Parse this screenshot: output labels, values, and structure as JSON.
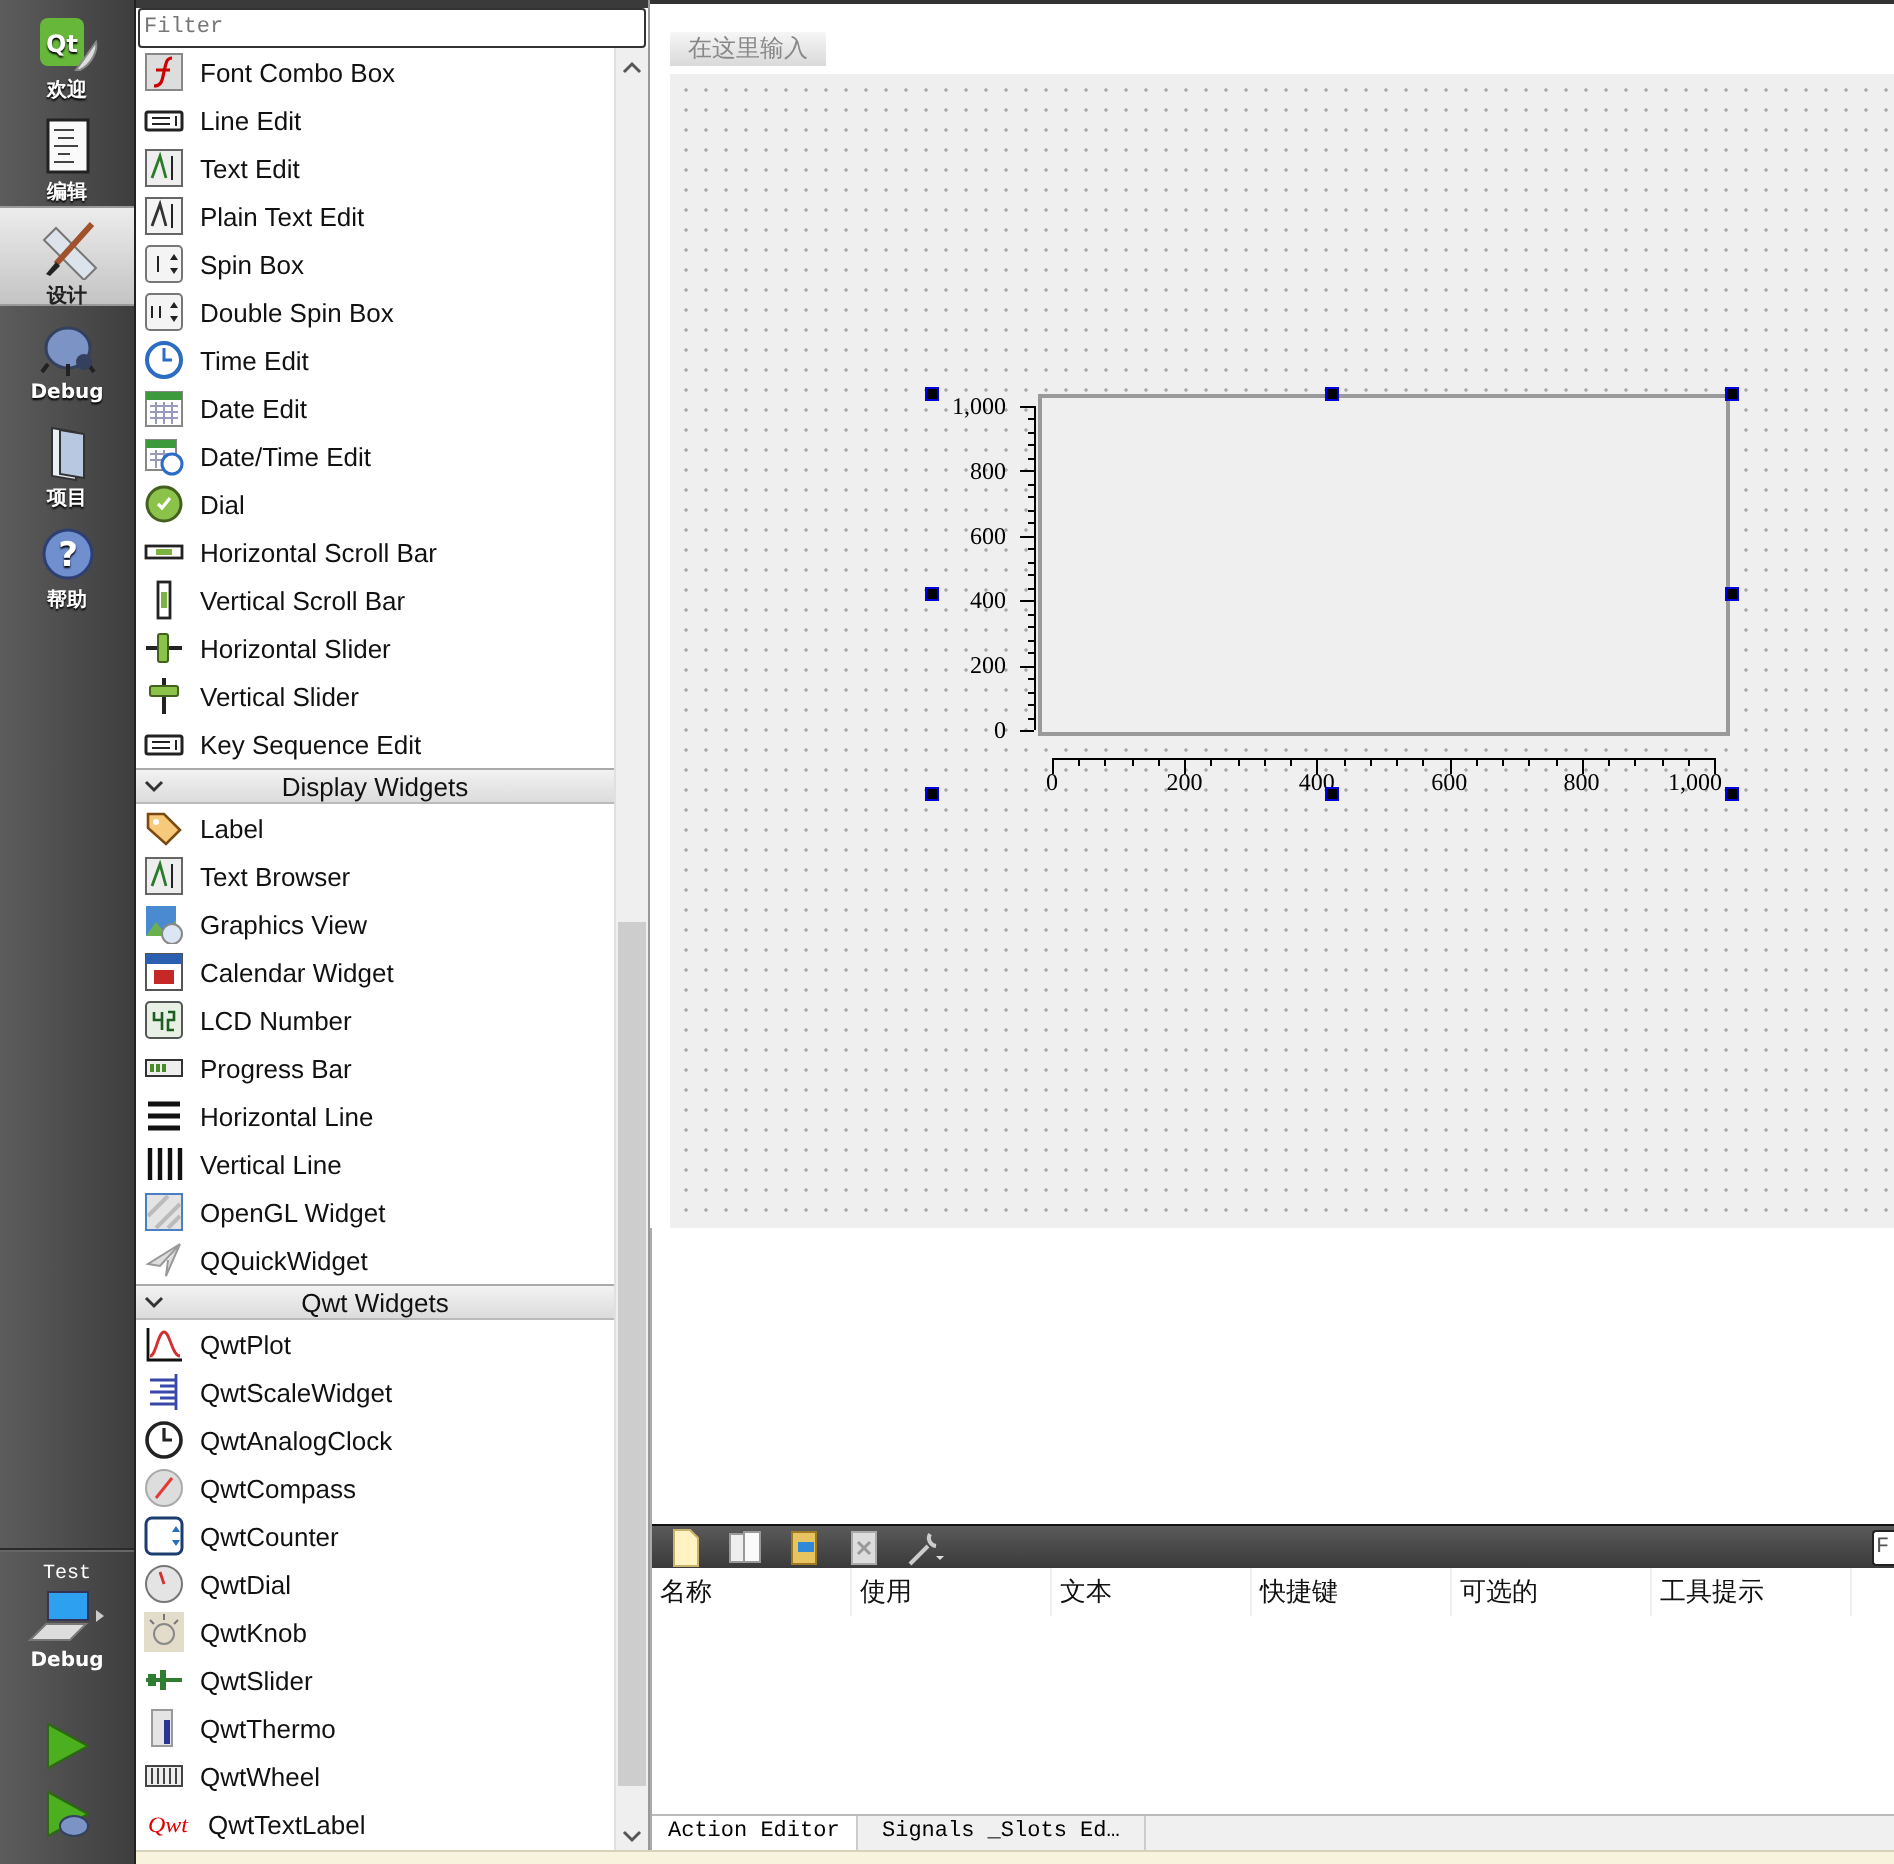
{
  "mode_bar": {
    "modes": [
      {
        "kind": "welcome",
        "label": "欢迎",
        "icon_text": "Qt",
        "selected": false
      },
      {
        "kind": "edit",
        "label": "编辑",
        "selected": false
      },
      {
        "kind": "design",
        "label": "设计",
        "selected": true
      },
      {
        "kind": "debug",
        "label": "Debug",
        "selected": false
      },
      {
        "kind": "projects",
        "label": "项目",
        "selected": false
      },
      {
        "kind": "help",
        "label": "帮助",
        "icon_text": "?",
        "selected": false
      }
    ],
    "kit": {
      "project": "Test",
      "build": "Debug"
    }
  },
  "widget_box": {
    "filter": {
      "placeholder": "Filter"
    },
    "sections": [
      {
        "items": [
          {
            "kind": "font",
            "label": "Font Combo Box"
          },
          {
            "kind": "line-edit",
            "label": "Line Edit"
          },
          {
            "kind": "text-edit",
            "label": "Text Edit"
          },
          {
            "kind": "plain-text",
            "label": "Plain Text Edit"
          },
          {
            "kind": "spin",
            "label": "Spin Box"
          },
          {
            "kind": "double-spin",
            "label": "Double Spin Box"
          },
          {
            "kind": "time",
            "label": "Time Edit"
          },
          {
            "kind": "date",
            "label": "Date Edit"
          },
          {
            "kind": "datetime",
            "label": "Date/Time Edit"
          },
          {
            "kind": "dial",
            "label": "Dial"
          },
          {
            "kind": "hscroll",
            "label": "Horizontal Scroll Bar"
          },
          {
            "kind": "vscroll",
            "label": "Vertical Scroll Bar"
          },
          {
            "kind": "hslider",
            "label": "Horizontal Slider"
          },
          {
            "kind": "vslider",
            "label": "Vertical Slider"
          },
          {
            "kind": "line-edit",
            "label": "Key Sequence Edit"
          }
        ]
      },
      {
        "title": "Display Widgets",
        "expanded": true,
        "items": [
          {
            "kind": "label",
            "label": "Label"
          },
          {
            "kind": "text-edit",
            "label": "Text Browser"
          },
          {
            "kind": "graphics",
            "label": "Graphics View"
          },
          {
            "kind": "calendar",
            "label": "Calendar Widget"
          },
          {
            "kind": "lcd",
            "label": "LCD Number"
          },
          {
            "kind": "progress",
            "label": "Progress Bar"
          },
          {
            "kind": "hline",
            "label": "Horizontal Line"
          },
          {
            "kind": "vline",
            "label": "Vertical Line"
          },
          {
            "kind": "opengl",
            "label": "OpenGL Widget"
          },
          {
            "kind": "quick",
            "label": "QQuickWidget"
          }
        ]
      },
      {
        "title": "Qwt Widgets",
        "expanded": true,
        "items": [
          {
            "kind": "plot",
            "label": "QwtPlot"
          },
          {
            "kind": "scale",
            "label": "QwtScaleWidget"
          },
          {
            "kind": "clock",
            "label": "QwtAnalogClock"
          },
          {
            "kind": "compass",
            "label": "QwtCompass"
          },
          {
            "kind": "counter",
            "label": "QwtCounter"
          },
          {
            "kind": "qdial",
            "label": "QwtDial"
          },
          {
            "kind": "knob",
            "label": "QwtKnob"
          },
          {
            "kind": "qslider",
            "label": "QwtSlider"
          },
          {
            "kind": "thermo",
            "label": "QwtThermo"
          },
          {
            "kind": "wheel",
            "label": "QwtWheel"
          },
          {
            "kind": "textlabel",
            "label": "QwtTextLabel",
            "icon_text": "Qwt"
          }
        ]
      }
    ]
  },
  "form": {
    "menu_placeholder": "在这里输入",
    "plot": {
      "selected": true,
      "chart_data": {
        "type": "line",
        "xlim": [
          0,
          1000
        ],
        "ylim": [
          0,
          1000
        ],
        "xticks": [
          0,
          200,
          400,
          600,
          800,
          {
            "value": 1000,
            "label": "1,000"
          }
        ],
        "yticks": [
          0,
          200,
          400,
          600,
          800,
          {
            "value": 1000,
            "label": "1,000"
          }
        ]
      }
    }
  },
  "action_editor": {
    "filter": {
      "placeholder": "F"
    },
    "columns": [
      "名称",
      "使用",
      "文本",
      "快捷键",
      "可选的",
      "工具提示"
    ],
    "tabs": [
      {
        "label": "Action Editor",
        "selected": true
      },
      {
        "label": "Signals _Slots Ed…",
        "selected": false
      }
    ]
  }
}
